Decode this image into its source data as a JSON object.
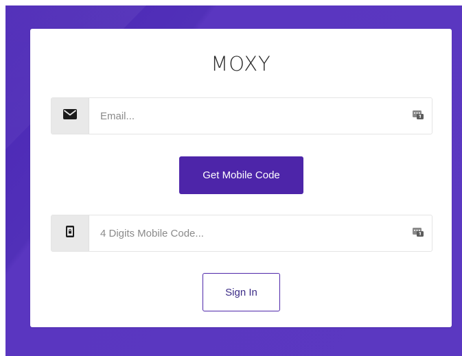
{
  "brand": {
    "title": "MOXY"
  },
  "form": {
    "email": {
      "placeholder": "Email...",
      "value": "",
      "icon": "envelope-icon",
      "autofill_icon": "autofill-key-icon"
    },
    "get_code_button": {
      "label": "Get Mobile Code"
    },
    "mobile_code": {
      "placeholder": "4 Digits Mobile Code...",
      "value": "",
      "icon": "mobile-lock-icon",
      "autofill_icon": "autofill-key-icon"
    },
    "sign_in_button": {
      "label": "Sign In"
    }
  },
  "colors": {
    "background": "#5b38c1",
    "accent": "#4d25a9",
    "card": "#ffffff",
    "addon": "#e9e9e9"
  }
}
